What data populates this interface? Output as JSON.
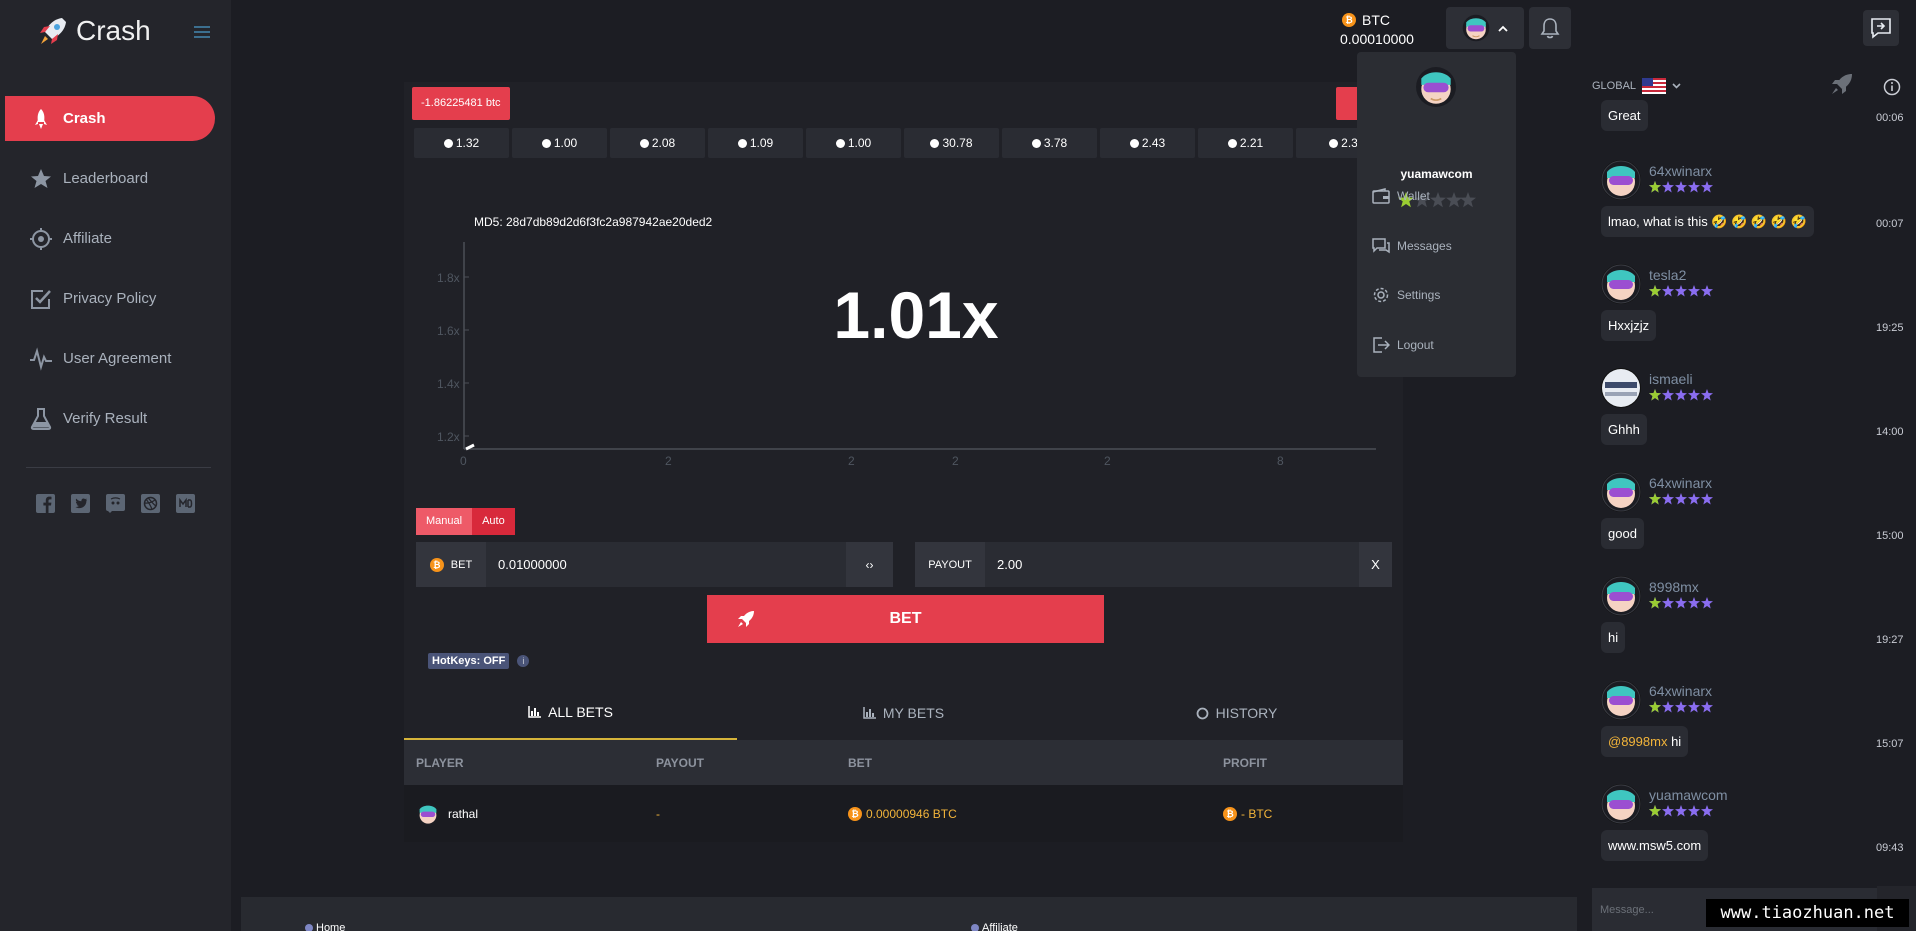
{
  "app": {
    "logo_text": "Crash"
  },
  "sidebar": {
    "items": [
      {
        "label": "Crash",
        "icon": "rocket-icon",
        "active": true
      },
      {
        "label": "Leaderboard",
        "icon": "star-icon"
      },
      {
        "label": "Affiliate",
        "icon": "target-icon"
      },
      {
        "label": "Privacy Policy",
        "icon": "checkbox-icon"
      },
      {
        "label": "User Agreement",
        "icon": "pulse-icon"
      },
      {
        "label": "Verify Result",
        "icon": "flask-icon"
      }
    ],
    "socials": [
      "facebook-icon",
      "twitter-icon",
      "discord-icon",
      "dribbble-icon",
      "medium-icon"
    ]
  },
  "header": {
    "currency": "BTC",
    "balance": "0.00010000"
  },
  "dropdown": {
    "username": "yuamawcom",
    "rating": 1,
    "items": [
      {
        "label": "Wallet",
        "icon": "wallet-icon"
      },
      {
        "label": "Messages",
        "icon": "messages-icon"
      },
      {
        "label": "Settings",
        "icon": "gear-icon"
      },
      {
        "label": "Logout",
        "icon": "logout-icon"
      }
    ]
  },
  "game": {
    "last_bet": "-1.86225481 btc",
    "history": [
      "1.32",
      "1.00",
      "2.08",
      "1.09",
      "1.00",
      "30.78",
      "3.78",
      "2.43",
      "2.21",
      "2.3"
    ],
    "md5": "MD5: 28d7db89d2d6f3fc2a987942ae20ded2",
    "multiplier": "1.01x",
    "y_ticks": [
      "1.8x",
      "1.6x",
      "1.4x",
      "1.2x"
    ],
    "x_ticks": [
      "0",
      "2",
      "2",
      "2",
      "2",
      "8"
    ],
    "mode_manual": "Manual",
    "mode_auto": "Auto",
    "bet_label": "BET",
    "bet_value": "0.01000000",
    "swap_symbol": "‹›",
    "payout_label": "PAYOUT",
    "payout_value": "2.00",
    "clear_symbol": "X",
    "bet_button": "BET",
    "hotkeys": "HotKeys: OFF",
    "info_symbol": "i"
  },
  "tabs": [
    {
      "label": "ALL BETS",
      "icon": "bar-chart-icon",
      "active": true
    },
    {
      "label": "MY BETS",
      "icon": "bar-chart-icon"
    },
    {
      "label": "HISTORY",
      "icon": "history-icon"
    }
  ],
  "table": {
    "headers": [
      "PLAYER",
      "PAYOUT",
      "BET",
      "PROFIT"
    ],
    "rows": [
      {
        "player": "rathal",
        "payout": "-",
        "bet": "0.00000946 BTC",
        "profit": "- BTC"
      }
    ]
  },
  "footer": {
    "links": [
      "Home",
      "Affiliate"
    ]
  },
  "chat": {
    "channel": "GLOBAL",
    "messages": [
      {
        "user": "",
        "text": "Great",
        "time": "00:06",
        "stars": 0
      },
      {
        "user": "64xwinarx",
        "text": "lmao, what is this 🤣 🤣 🤣 🤣 🤣",
        "time": "00:07",
        "stars": 5
      },
      {
        "user": "tesla2",
        "text": "Hxxjzjz",
        "time": "19:25",
        "stars": 5
      },
      {
        "user": "ismaeli",
        "text": "Ghhh",
        "time": "14:00",
        "stars": 5
      },
      {
        "user": "64xwinarx",
        "text": "good",
        "time": "15:00",
        "stars": 5
      },
      {
        "user": "8998mx",
        "text": "hi",
        "time": "19:27",
        "stars": 5
      },
      {
        "user": "64xwinarx",
        "mention": "@8998mx",
        "text": " hi",
        "time": "15:07",
        "stars": 5
      },
      {
        "user": "yuamawcom",
        "text": "www.msw5.com",
        "time": "09:43",
        "stars": 5
      }
    ],
    "input_placeholder": "Message..."
  },
  "watermark": "www.tiaozhuan.net",
  "colors": {
    "accent": "#e43e4d",
    "gold": "#f2b43a",
    "star_green": "#9acd32",
    "star_purple": "#8a6df0"
  }
}
